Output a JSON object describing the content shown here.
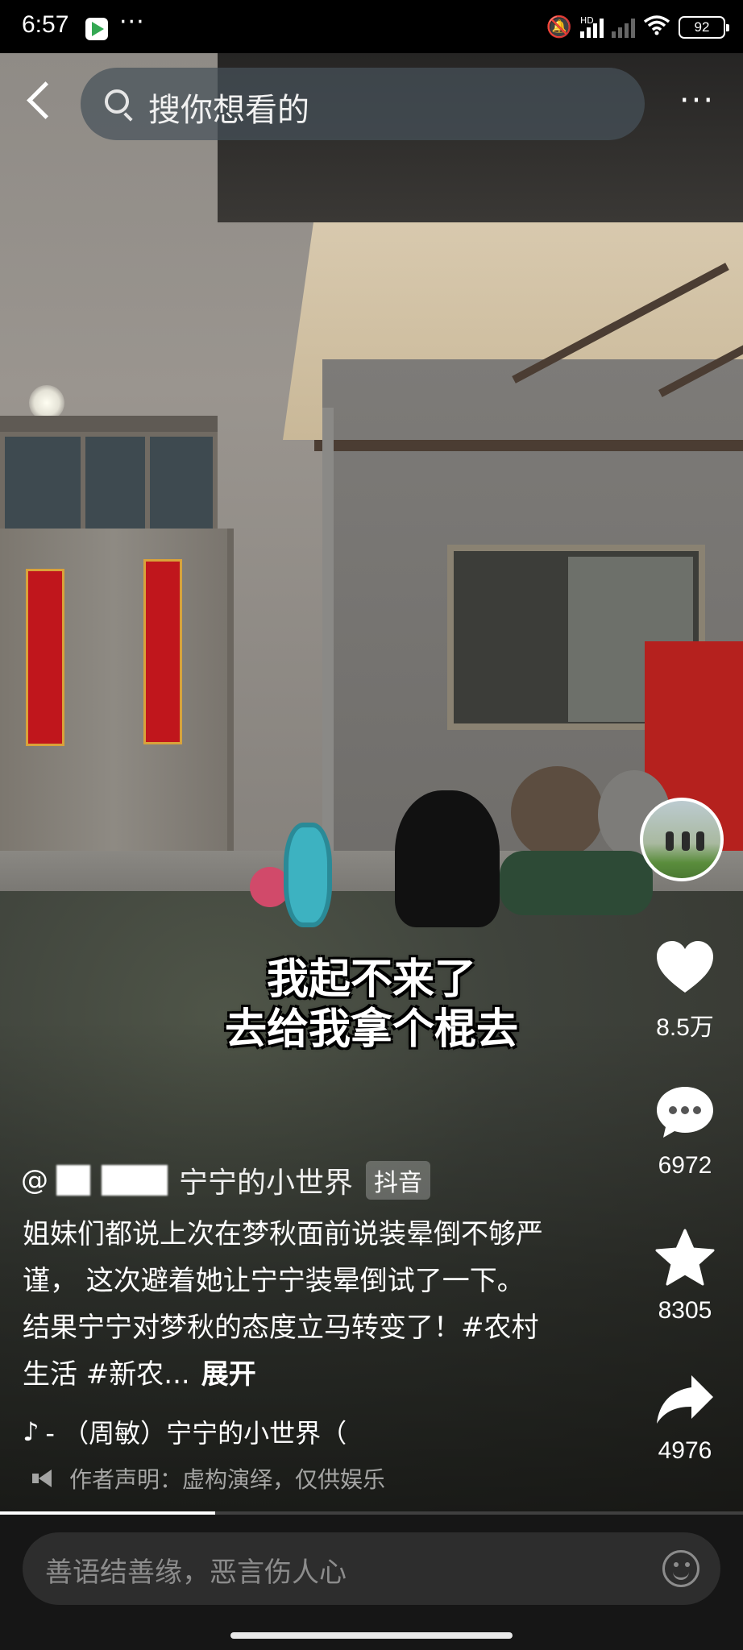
{
  "status_bar": {
    "time": "6:57",
    "dots": "···",
    "battery": "92",
    "hd_label": "HD"
  },
  "top_bar": {
    "search_placeholder": "搜你想看的",
    "more_label": "···"
  },
  "subtitle": {
    "line1": "我起不来了",
    "line2": "去给我拿个棍去"
  },
  "rail": {
    "likes": "8.5万",
    "comments": "6972",
    "favorites": "8305",
    "shares": "4976"
  },
  "author": {
    "at": "@",
    "name_visible": "宁宁的小世界",
    "platform_tag": "抖音"
  },
  "caption": {
    "text": "姐妹们都说上次在梦秋面前说装晕倒不够严谨， 这次避着她让宁宁装晕倒试了一下。结果宁宁对梦秋的态度立马转变了！#农村生活 #新农...",
    "expand_label": "展开"
  },
  "music": {
    "icon": "♪",
    "text": "- （周敏）宁宁的小世界（"
  },
  "disclaimer": {
    "text": "作者声明：虚构演绎，仅供娱乐"
  },
  "progress": {
    "fraction": 0.29
  },
  "comment_bar": {
    "placeholder": "善语结善缘，恶言伤人心"
  }
}
